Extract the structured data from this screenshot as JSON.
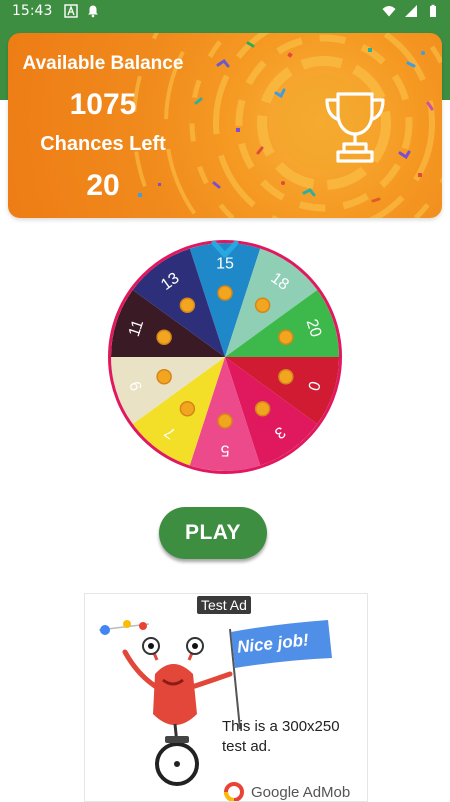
{
  "status_bar": {
    "time": "15:43",
    "icons_left": [
      "text-a-icon",
      "notification-bell-icon"
    ],
    "icons_right": [
      "wifi-icon",
      "signal-icon",
      "battery-icon"
    ]
  },
  "banner": {
    "balance_label": "Available Balance",
    "balance_value": "1075",
    "chances_label": "Chances Left",
    "chances_value": "20",
    "icon": "trophy-icon"
  },
  "wheel": {
    "segments": [
      {
        "label": "15",
        "color": "#1e88c8"
      },
      {
        "label": "18",
        "color": "#8fcfb5"
      },
      {
        "label": "20",
        "color": "#3cb94a"
      },
      {
        "label": "0",
        "color": "#d01b33"
      },
      {
        "label": "3",
        "color": "#e0195e"
      },
      {
        "label": "5",
        "color": "#ec4a8a"
      },
      {
        "label": "7",
        "color": "#f3df28"
      },
      {
        "label": "9",
        "color": "#e9e2c4"
      },
      {
        "label": "11",
        "color": "#3a1a24"
      },
      {
        "label": "13",
        "color": "#2e2f7a"
      }
    ],
    "rim_color": "#e0195e",
    "pointer_color": "#29a8e0"
  },
  "play_button": {
    "label": "PLAY"
  },
  "ad": {
    "tag": "Test Ad",
    "flag_text": "Nice job!",
    "text": "This is a 300x250 test ad.",
    "brand": "Google AdMob"
  },
  "colors": {
    "primary_green": "#3e8e41",
    "banner_orange": "#f59a23"
  }
}
